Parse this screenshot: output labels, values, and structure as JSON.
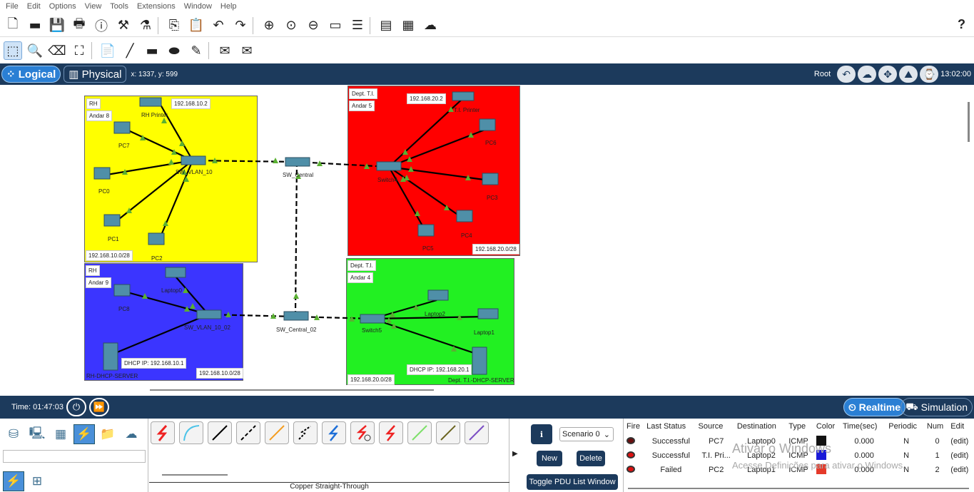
{
  "menu": [
    "File",
    "Edit",
    "Options",
    "View",
    "Tools",
    "Extensions",
    "Window",
    "Help"
  ],
  "toolbar_icons": [
    "new-icon",
    "open-icon",
    "save-icon",
    "print-icon",
    "info-icon",
    "wizard-icon",
    "activity-icon",
    "copy-icon",
    "paste-icon",
    "undo-icon",
    "redo-icon",
    "zoom-in-icon",
    "zoom-reset-icon",
    "zoom-out-icon",
    "palette-icon",
    "custom-devices-icon",
    "viewport-icon",
    "tools-icon",
    "image-icon"
  ],
  "help_label": "?",
  "nav": {
    "logical": "Logical",
    "physical": "Physical",
    "coords": "x: 1337, y: 599",
    "root": "Root",
    "clock": "13:02:00"
  },
  "areas": [
    {
      "id": "rh8",
      "color": "#ffff00",
      "tag1": "RH",
      "tag2": "Andar 8",
      "net": "192.168.10.0/28"
    },
    {
      "id": "ti5",
      "color": "#ff0000",
      "tag1": "Dept. T.I.",
      "tag2": "Andar 5",
      "net": "192.168.20.0/28"
    },
    {
      "id": "rh9",
      "color": "#3b35ff",
      "tag1": "RH",
      "tag2": "Andar 9",
      "net": "192.168.10.0/28"
    },
    {
      "id": "ti4",
      "color": "#22f022",
      "tag1": "Dept. T.I.",
      "tag2": "Andar 4",
      "net": "192.168.20.0/28"
    }
  ],
  "devices": {
    "rh_printer": "RH Printer",
    "rh_printer_ip": "192.168.10.2",
    "pc7": "PC7",
    "pc0": "PC0",
    "pc1": "PC1",
    "pc2": "PC2",
    "sw_vlan_10": "SW_VLAN_10",
    "sw_central": "SW_Central",
    "ti_printer": "T.I. Printer",
    "ti_printer_ip": "192.168.20.2",
    "pc6": "PC6",
    "pc3": "PC3",
    "pc4": "PC4",
    "pc5": "PC5",
    "switch4": "Switch4",
    "laptop0": "Laptop0",
    "pc8": "PC8",
    "sw_vlan_10_02": "SW_VLAN_10_02",
    "sw_central_02": "SW_Central_02",
    "rh_dhcp_ip": "DHCP IP: 192.168.10.1",
    "rh_dhcp": "RH-DHCP-SERVER",
    "laptop2": "Laptop2",
    "laptop1": "Laptop1",
    "switch5": "Switch5",
    "ti_dhcp_ip": "DHCP IP: 192.168.20.1",
    "ti_dhcp": "Dept. T.I.-DHCP-SERVER"
  },
  "timebar": {
    "time": "Time: 01:47:03",
    "realtime": "Realtime",
    "simulation": "Simulation"
  },
  "device_categories": [
    "network-devices-icon",
    "end-devices-icon",
    "components-icon",
    "connections-icon",
    "misc-icon",
    "multiuser-icon"
  ],
  "connection_types": [
    "automatic-cable",
    "console-cable",
    "copper-straight",
    "copper-cross",
    "fiber-cable",
    "phone-cable",
    "coaxial-cable",
    "serial-dce",
    "serial-dte",
    "octal-cable",
    "iot-cable",
    "usb-cable"
  ],
  "cable_label": "Copper Straight-Through",
  "scenario": {
    "selected": "Scenario 0",
    "new": "New",
    "delete": "Delete",
    "toggle": "Toggle PDU List Window"
  },
  "pdu_headers": [
    "Fire",
    "Last Status",
    "Source",
    "Destination",
    "Type",
    "Color",
    "Time(sec)",
    "Periodic",
    "Num",
    "Edit"
  ],
  "pdu_rows": [
    {
      "status": "Successful",
      "source": "PC7",
      "dest": "Laptop0",
      "type": "ICMP",
      "color": "#111111",
      "time": "0.000",
      "periodic": "N",
      "num": "0",
      "edit": "(edit)"
    },
    {
      "status": "Successful",
      "source": "T.I. Pri...",
      "dest": "Laptop2",
      "type": "ICMP",
      "color": "#1a1ad8",
      "time": "0.000",
      "periodic": "N",
      "num": "1",
      "edit": "(edit)"
    },
    {
      "status": "Failed",
      "source": "PC2",
      "dest": "Laptop1",
      "type": "ICMP",
      "color": "#e53a2a",
      "time": "0.000",
      "periodic": "N",
      "num": "2",
      "edit": "(edit)"
    }
  ],
  "watermark": {
    "line1": "Ativar o Windows",
    "line2": "Acesse Definições para ativar o Windows."
  }
}
